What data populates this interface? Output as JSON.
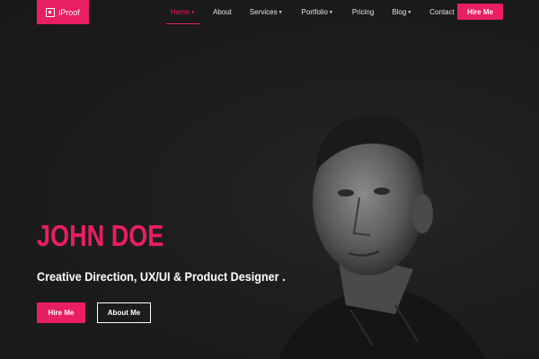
{
  "nav": {
    "brand": "iProof",
    "items": [
      {
        "label": "Home",
        "has_caret": true,
        "active": true
      },
      {
        "label": "About",
        "has_caret": false,
        "active": false
      },
      {
        "label": "Services",
        "has_caret": true,
        "active": false
      },
      {
        "label": "Portfolio",
        "has_caret": true,
        "active": false
      },
      {
        "label": "Pricing",
        "has_caret": false,
        "active": false
      },
      {
        "label": "Blog",
        "has_caret": true,
        "active": false
      },
      {
        "label": "Contact",
        "has_caret": false,
        "active": false
      }
    ],
    "cta": "Hire Me"
  },
  "hero": {
    "name": "JOHN DOE",
    "subtitle": "Creative Direction, UX/UI & Product Designer .",
    "primary_button": "Hire Me",
    "secondary_button": "About Me"
  },
  "colors": {
    "accent": "#e91e63",
    "background": "#1c1c1c",
    "text": "#ffffff"
  },
  "icons": {
    "brand": "logo-icon",
    "caret": "caret-down-icon"
  }
}
